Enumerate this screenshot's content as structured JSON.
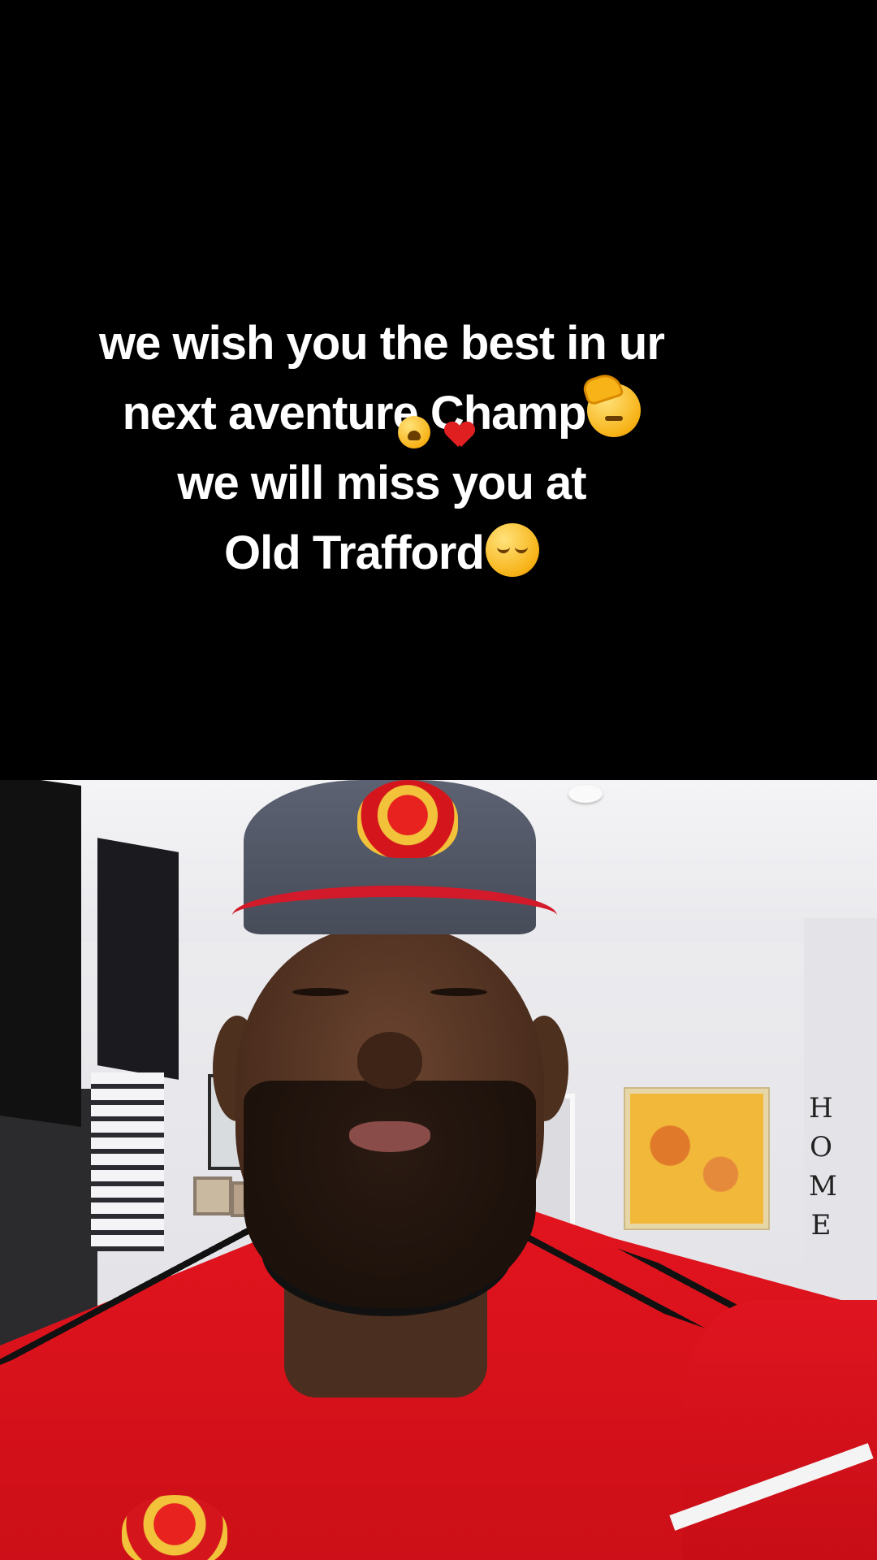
{
  "caption": {
    "line1": "we wish you the best in ur",
    "line2_text": "next aventure Champ",
    "line2_emoji": "saluting-face",
    "line3": "we will miss you at",
    "line4_text": "Old Trafford",
    "line4_emoji": "relieved-face",
    "overlay_emojis": [
      "loudly-crying-face",
      "red-heart"
    ]
  },
  "scene": {
    "wall_sign": [
      "H",
      "O",
      "M",
      "E"
    ]
  },
  "colors": {
    "background": "#000000",
    "caption_text": "#ffffff",
    "jersey_red": "#e2141e",
    "cap_blue": "#5c6272"
  }
}
